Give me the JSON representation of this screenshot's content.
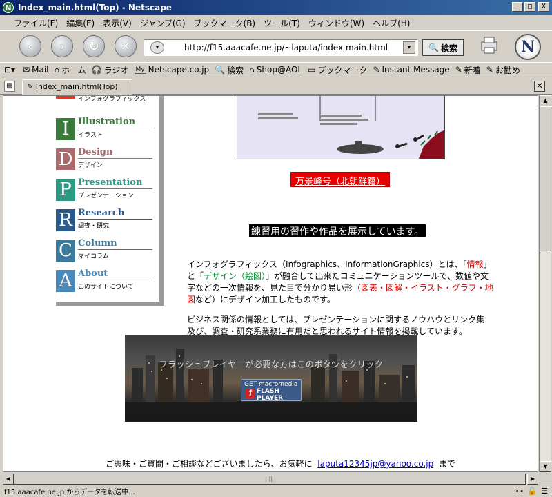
{
  "window": {
    "title": "Index_main.html(Top) - Netscape",
    "app_icon": "N",
    "minimize": "_",
    "maximize": "□",
    "close": "X"
  },
  "menubar": {
    "items": [
      "ファイル(F)",
      "編集(E)",
      "表示(V)",
      "ジャンプ(G)",
      "ブックマーク(B)",
      "ツール(T)",
      "ウィンドウ(W)",
      "ヘルプ(H)"
    ]
  },
  "navbar": {
    "url": "http://f15.aaacafe.ne.jp/~laputa/index main.html",
    "search_label": "検索",
    "logo_letter": "N"
  },
  "personal_toolbar": {
    "items": [
      {
        "icon": "✉",
        "label": "Mail"
      },
      {
        "icon": "⌂",
        "label": "ホーム"
      },
      {
        "icon": "🎧",
        "label": "ラジオ"
      },
      {
        "icon": "My",
        "label": "Netscape.co.jp"
      },
      {
        "icon": "🔍",
        "label": "検索"
      },
      {
        "icon": "⌂",
        "label": "Shop@AOL"
      },
      {
        "icon": "▭",
        "label": "ブックマーク"
      },
      {
        "icon": "✎",
        "label": "Instant Message"
      },
      {
        "icon": "✎",
        "label": "新着"
      },
      {
        "icon": "✎",
        "label": "お勧め"
      }
    ]
  },
  "tab": {
    "label": "Index_main.html(Top)"
  },
  "sidebar_nav": {
    "items": [
      {
        "letter": "I",
        "title": "",
        "subtitle": "インフォグラフィックス",
        "color": "#d23a2a"
      },
      {
        "letter": "I",
        "title": "Illustration",
        "subtitle": "イラスト",
        "color": "#3a7a3a"
      },
      {
        "letter": "D",
        "title": "Design",
        "subtitle": "デザイン",
        "color": "#a86a6a"
      },
      {
        "letter": "P",
        "title": "Presentation",
        "subtitle": "プレゼンテーション",
        "color": "#2a9a82"
      },
      {
        "letter": "R",
        "title": "Research",
        "subtitle": "調査・研究",
        "color": "#2a5a8a"
      },
      {
        "letter": "C",
        "title": "Column",
        "subtitle": "マイコラム",
        "color": "#3a7a9a"
      },
      {
        "letter": "A",
        "title": "About",
        "subtitle": "このサイトについて",
        "color": "#4a8aba"
      }
    ]
  },
  "main": {
    "image_label": "万景峰号（北朝鮮籍）",
    "caption": "練習用の習作や作品を展示しています。",
    "desc1_a": "インフォグラフィックス（Infographics、InformationGraphics）とは、「",
    "desc1_info": "情報",
    "desc1_b": "」と「",
    "desc1_design": "デザイン（絵図）",
    "desc1_c": "」が融合して出来たコミュニケーションツールで、数値や文字などの一次情報を、見た目で分かり易い形（",
    "desc1_examples": "図表・図解・イラスト・グラフ・地図",
    "desc1_d": "など）にデザイン加工したものです。",
    "desc2": "ビジネス関係の情報としては、プレゼンテーションに関するノウハウとリンク集及び、調査・研究系業務に有用だと思われるサイト情報を掲載しています。",
    "flash_message": "フラッシュプレイヤーが必要な方はこのボタンをクリック",
    "flash_button": {
      "line1": "GET macromedia",
      "line2": "FLASH",
      "line3": "PLAYER"
    },
    "footer_prefix": "ご興味・ご質問・ご相談などございましたら、お気軽に",
    "footer_email": "laputa12345jp@yahoo.co.jp",
    "footer_suffix": "まで"
  },
  "statusbar": {
    "text": "f15.aaacafe.ne.jp からデータを転送中..."
  }
}
